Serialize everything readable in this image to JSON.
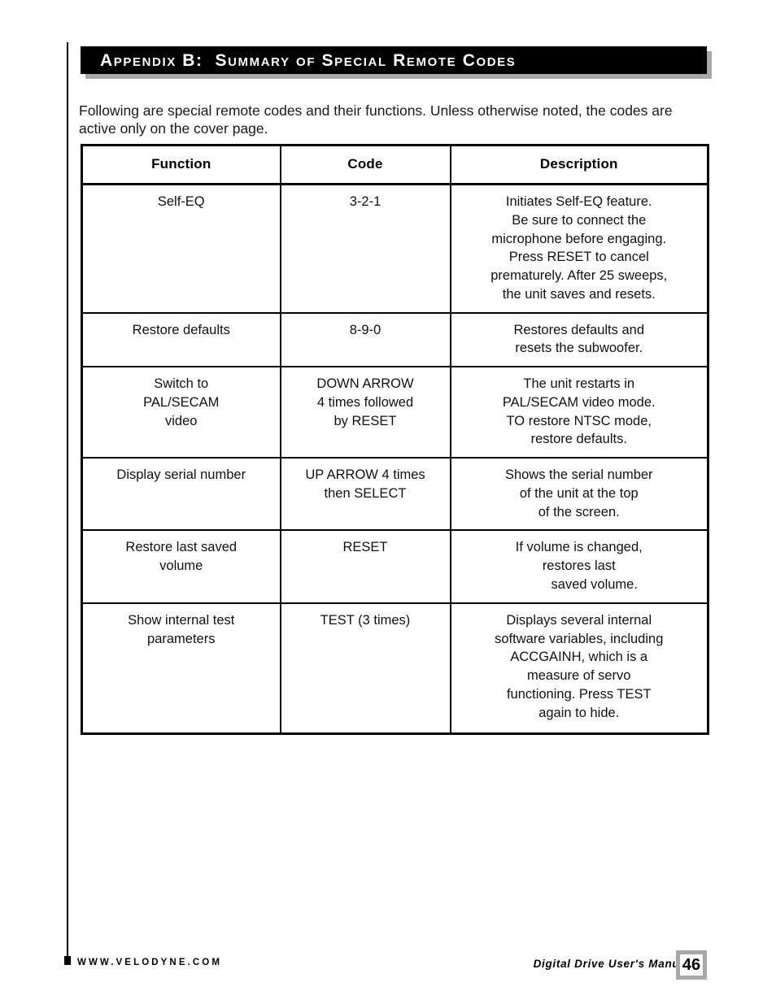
{
  "page": {
    "appendix_banner": "Appendix B:  Summary of Special Remote Codes",
    "intro": "Following are special remote codes and their functions.  Unless otherwise noted, the codes are\nactive only on the cover page."
  },
  "table": {
    "headers": {
      "function": "Function",
      "code": "Code",
      "description": "Description"
    },
    "rows": [
      {
        "function": "Self-EQ",
        "code": "3-2-1",
        "description": "Initiates Self-EQ feature.\nBe sure to connect the\nmicrophone before engaging.\nPress RESET to cancel\nprematurely. After 25 sweeps,\nthe unit saves and resets."
      },
      {
        "function": "Restore defaults",
        "code": "8-9-0",
        "description": "Restores defaults and\nresets the subwoofer."
      },
      {
        "function": "Switch to\nPAL/SECAM\nvideo",
        "code": "DOWN ARROW\n4 times followed\nby RESET",
        "description": "The unit restarts in\nPAL/SECAM video mode.\nTO restore NTSC mode,\nrestore defaults."
      },
      {
        "function": "Display serial number",
        "code": "UP ARROW 4 times\nthen SELECT",
        "description": "Shows the serial number\nof the unit at the top\nof the screen."
      },
      {
        "function": "Restore last saved\nvolume",
        "code": "RESET",
        "description_line1": "If volume is changed,",
        "description_line2": "restores last",
        "description_line3": "saved volume."
      },
      {
        "function": "Show internal test\nparameters",
        "code": "TEST (3 times)",
        "description": "Displays several internal\nsoftware variables, including\nACCGAINH, which is a\nmeasure of servo\nfunctioning. Press TEST\nagain to hide."
      }
    ]
  },
  "footer": {
    "url": "WWW.VELODYNE.COM",
    "manual_title": "Digital Drive User's Manual",
    "page_number": "46"
  },
  "colors": {
    "banner_bg": "#000000",
    "banner_shadow": "#a8a8a8",
    "page_box_border": "#a8a8a8",
    "text": "#000000"
  }
}
